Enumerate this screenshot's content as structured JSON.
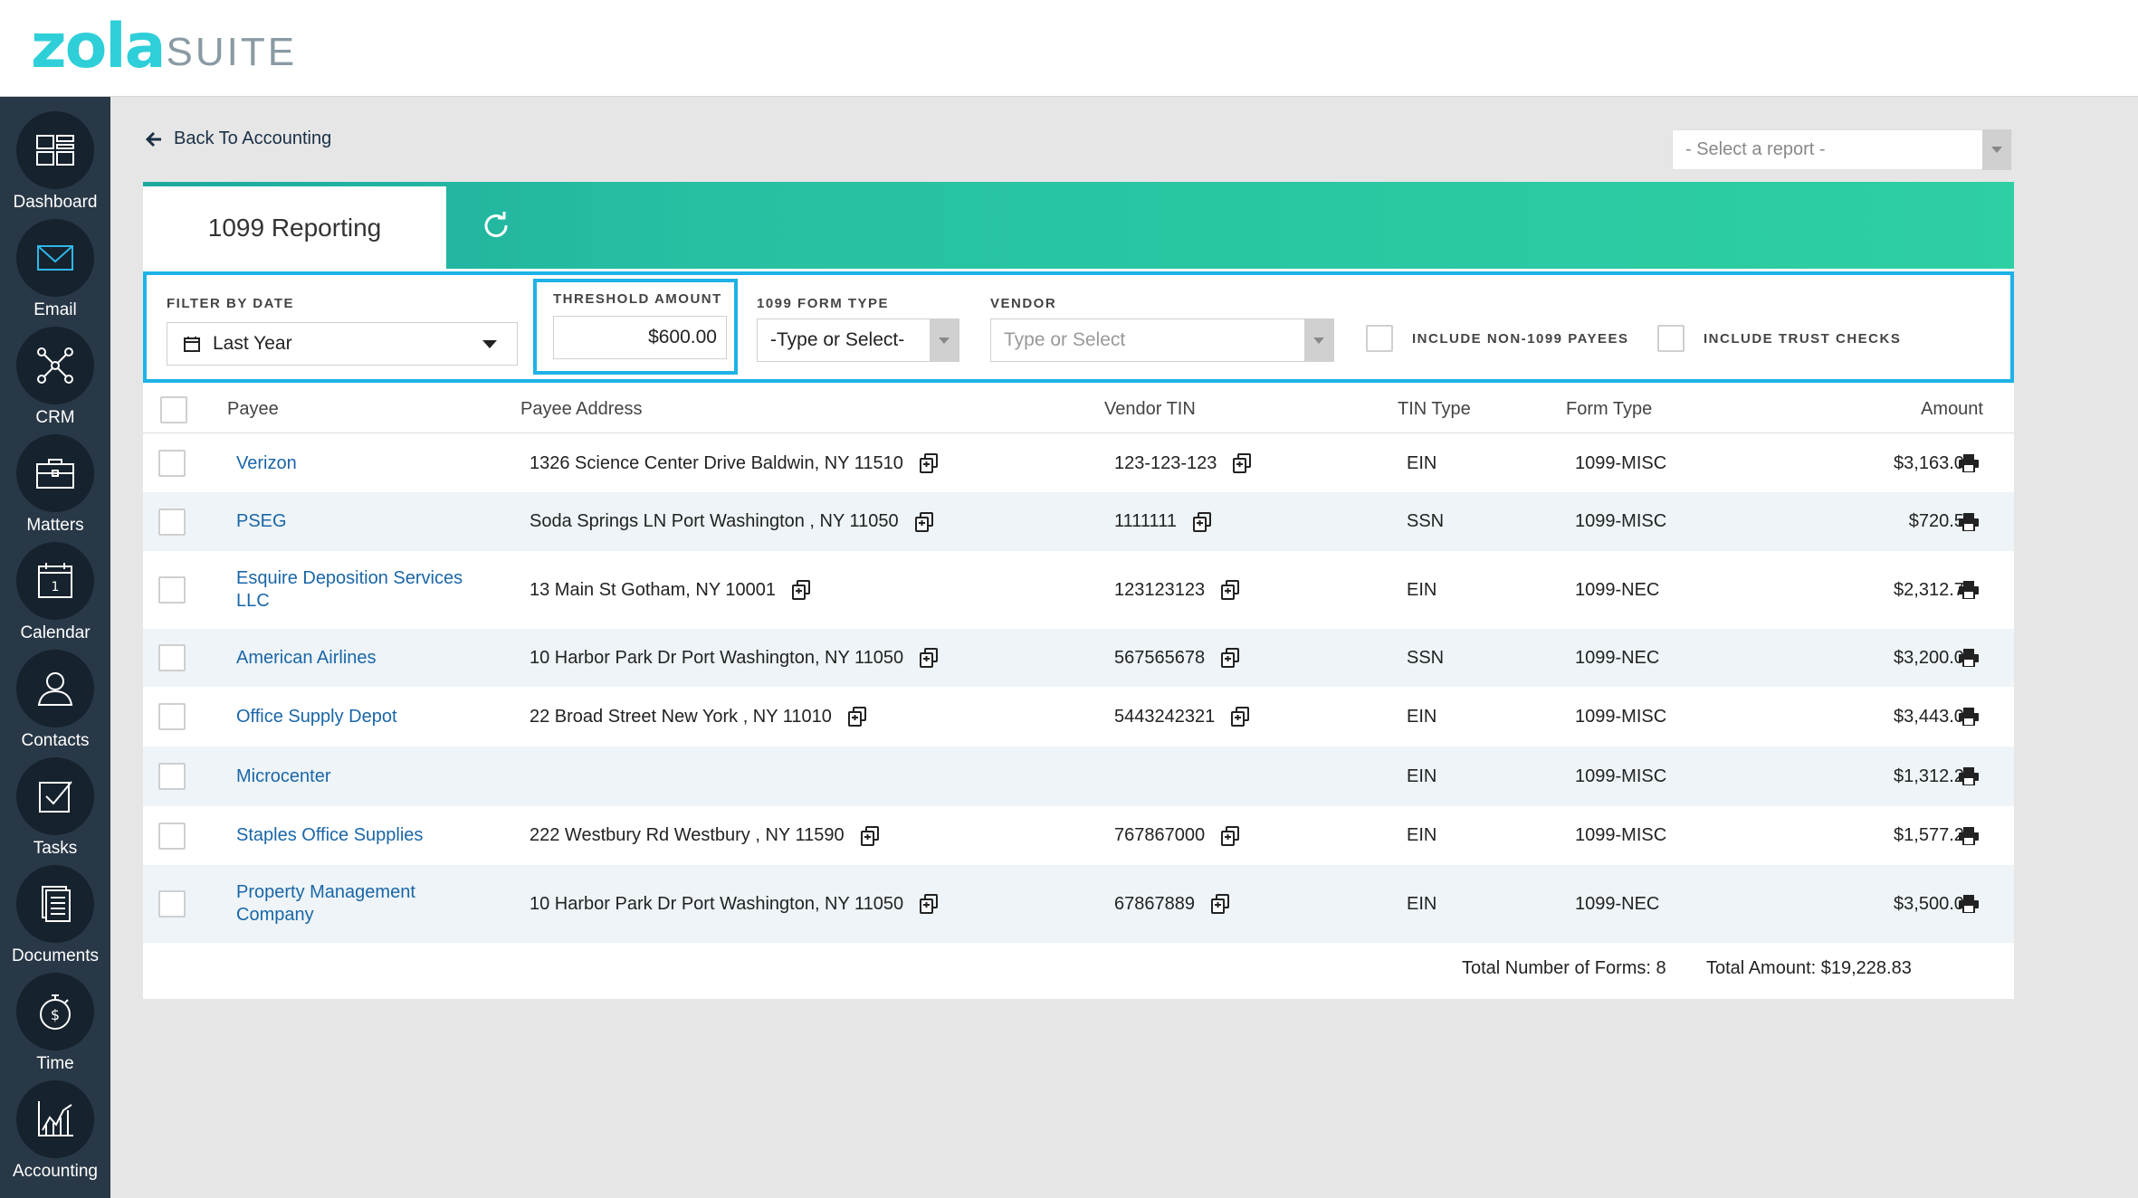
{
  "app": {
    "logo_primary": "zola",
    "logo_secondary": "SUITE"
  },
  "sidebar": {
    "items": [
      {
        "label": "Dashboard",
        "icon": "dashboard-icon"
      },
      {
        "label": "Email",
        "icon": "email-icon"
      },
      {
        "label": "CRM",
        "icon": "crm-icon"
      },
      {
        "label": "Matters",
        "icon": "briefcase-icon"
      },
      {
        "label": "Calendar",
        "icon": "calendar-icon"
      },
      {
        "label": "Contacts",
        "icon": "contacts-icon"
      },
      {
        "label": "Tasks",
        "icon": "tasks-icon"
      },
      {
        "label": "Documents",
        "icon": "documents-icon"
      },
      {
        "label": "Time",
        "icon": "stopwatch-icon"
      },
      {
        "label": "Accounting",
        "icon": "accounting-chart-icon"
      }
    ]
  },
  "nav": {
    "back_label": "Back To Accounting",
    "report_placeholder": "- Select a report -"
  },
  "page": {
    "tab_title": "1099 Reporting"
  },
  "filters": {
    "date_label": "FILTER BY DATE",
    "date_value": "Last Year",
    "threshold_label": "THRESHOLD AMOUNT",
    "threshold_value": "$600.00",
    "form_type_label": "1099 FORM TYPE",
    "form_type_value": "-Type or Select-",
    "vendor_label": "VENDOR",
    "vendor_placeholder": "Type or Select",
    "non1099_label": "INCLUDE NON-1099 PAYEES",
    "trust_label": "INCLUDE TRUST CHECKS"
  },
  "table": {
    "headers": {
      "payee": "Payee",
      "address": "Payee Address",
      "tin": "Vendor TIN",
      "tin_type": "TIN Type",
      "form_type": "Form Type",
      "amount": "Amount"
    },
    "rows": [
      {
        "payee": "Verizon",
        "address": "1326 Science Center Drive Baldwin, NY 11510",
        "tin": "123-123-123",
        "tin_type": "EIN",
        "form_type": "1099-MISC",
        "amount": "$3,163.00"
      },
      {
        "payee": "PSEG",
        "address": "Soda Springs LN Port Washington , NY 11050",
        "tin": "1111111",
        "tin_type": "SSN",
        "form_type": "1099-MISC",
        "amount": "$720.55"
      },
      {
        "payee": "Esquire Deposition Services LLC",
        "address": "13 Main St Gotham, NY 10001",
        "tin": "123123123",
        "tin_type": "EIN",
        "form_type": "1099-NEC",
        "amount": "$2,312.77"
      },
      {
        "payee": "American Airlines",
        "address": "10 Harbor Park Dr Port Washington, NY 11050",
        "tin": "567565678",
        "tin_type": "SSN",
        "form_type": "1099-NEC",
        "amount": "$3,200.00"
      },
      {
        "payee": "Office Supply Depot",
        "address": "22 Broad Street New York , NY 11010",
        "tin": "5443242321",
        "tin_type": "EIN",
        "form_type": "1099-MISC",
        "amount": "$3,443.00"
      },
      {
        "payee": "Microcenter",
        "address": "",
        "tin": "",
        "tin_type": "EIN",
        "form_type": "1099-MISC",
        "amount": "$1,312.28"
      },
      {
        "payee": "Staples Office Supplies",
        "address": "222 Westbury Rd Westbury , NY 11590",
        "tin": "767867000",
        "tin_type": "EIN",
        "form_type": "1099-MISC",
        "amount": "$1,577.23"
      },
      {
        "payee": "Property Management Company",
        "address": "10 Harbor Park Dr Port Washington, NY 11050",
        "tin": "67867889",
        "tin_type": "EIN",
        "form_type": "1099-NEC",
        "amount": "$3,500.00"
      }
    ],
    "totals": {
      "forms_label": "Total Number of Forms:",
      "forms_value": "8",
      "amount_label": "Total Amount:",
      "amount_value": "$19,228.83"
    }
  },
  "colors": {
    "accent": "#1eb2e6",
    "header_gradient_start": "#1da99e",
    "header_gradient_end": "#2ecfa2",
    "sidebar": "#283847",
    "link": "#1a66a8"
  }
}
